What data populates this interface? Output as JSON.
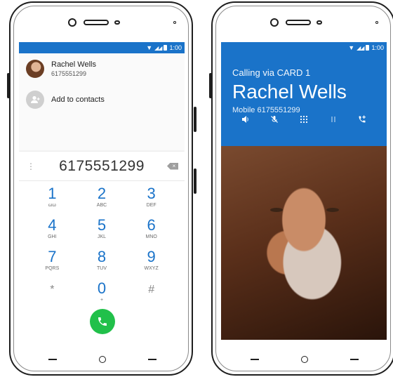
{
  "status": {
    "time": "1:00"
  },
  "dialer": {
    "suggestions": [
      {
        "name": "Rachel Wells",
        "number": "6175551299"
      },
      {
        "label": "Add to contacts"
      }
    ],
    "digits": "6175551299",
    "keys": [
      {
        "num": "1",
        "letters": "ωω"
      },
      {
        "num": "2",
        "letters": "ABC"
      },
      {
        "num": "3",
        "letters": "DEF"
      },
      {
        "num": "4",
        "letters": "GHI"
      },
      {
        "num": "5",
        "letters": "JKL"
      },
      {
        "num": "6",
        "letters": "MNO"
      },
      {
        "num": "7",
        "letters": "PQRS"
      },
      {
        "num": "8",
        "letters": "TUV"
      },
      {
        "num": "9",
        "letters": "WXYZ"
      },
      {
        "num": "*",
        "letters": ""
      },
      {
        "num": "0",
        "letters": "+"
      },
      {
        "num": "#",
        "letters": ""
      }
    ],
    "call_icon": "phone-icon"
  },
  "incall": {
    "via": "Calling via CARD 1",
    "name": "Rachel Wells",
    "detail": "Mobile 6175551299",
    "actions": [
      "speaker-icon",
      "mute-icon",
      "dialpad-icon",
      "hold-icon",
      "add-call-icon"
    ]
  },
  "colors": {
    "accent": "#1a73c9",
    "call": "#21c04a"
  }
}
